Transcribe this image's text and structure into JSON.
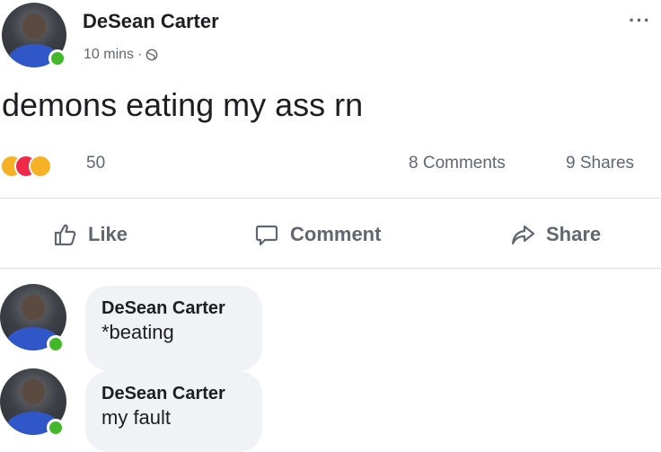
{
  "post": {
    "author": "DeSean Carter",
    "time": "10 mins",
    "separator": "·",
    "text": "demons eating my ass rn",
    "more": "···",
    "reaction_count": "50",
    "comments": "8 Comments",
    "shares": "9 Shares"
  },
  "actions": {
    "like": "Like",
    "comment": "Comment",
    "share": "Share"
  },
  "comments": [
    {
      "author": "DeSean Carter",
      "text": "*beating"
    },
    {
      "author": "DeSean Carter",
      "text": "my fault"
    }
  ],
  "icons": {
    "reactions": [
      "haha-icon",
      "love-icon",
      "wow-icon"
    ],
    "privacy": "globe-icon",
    "like": "thumbs-up-icon",
    "comment": "speech-bubble-icon",
    "share": "share-arrow-icon"
  },
  "colors": {
    "online": "#42b72a",
    "love": "#f0284a",
    "haha": "#f7b125",
    "muted_text": "#606770",
    "bubble": "#f0f2f5"
  }
}
